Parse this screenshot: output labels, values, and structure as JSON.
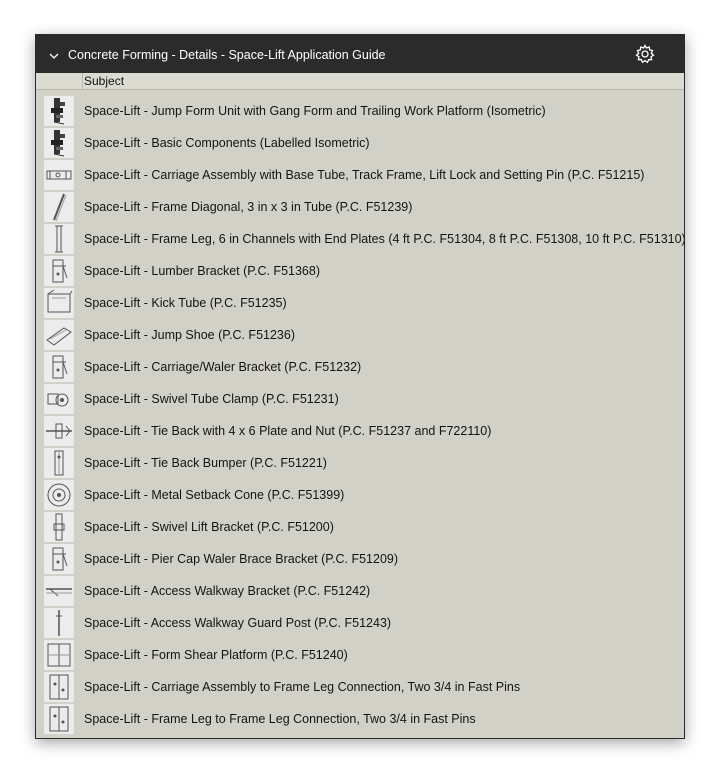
{
  "header": {
    "title": "Concrete Forming - Details - Space-Lift Application Guide",
    "chevron_icon": "chevron-down-icon",
    "settings_icon": "gear-icon"
  },
  "columns": {
    "subject": "Subject"
  },
  "rows": [
    {
      "label": "Space-Lift - Jump Form Unit with Gang Form and Trailing Work Platform (Isometric)",
      "thumb": "isometric-assembly-dark"
    },
    {
      "label": "Space-Lift - Basic Components (Labelled Isometric)",
      "thumb": "isometric-assembly-dark"
    },
    {
      "label": "Space-Lift - Carriage Assembly with Base Tube, Track Frame, Lift Lock and Setting Pin (P.C. F51215)",
      "thumb": "carriage-sketch"
    },
    {
      "label": "Space-Lift - Frame Diagonal, 3 in x 3 in Tube (P.C. F51239)",
      "thumb": "diagonal-tube"
    },
    {
      "label": "Space-Lift - Frame Leg, 6 in Channels with End Plates (4 ft P.C. F51304, 8 ft P.C. F51308, 10 ft P.C. F51310)",
      "thumb": "frame-leg"
    },
    {
      "label": "Space-Lift - Lumber Bracket (P.C. F51368)",
      "thumb": "bracket-sketch"
    },
    {
      "label": "Space-Lift - Kick Tube (P.C. F51235)",
      "thumb": "tube-sketch"
    },
    {
      "label": "Space-Lift - Jump Shoe (P.C. F51236)",
      "thumb": "shoe-sketch"
    },
    {
      "label": "Space-Lift - Carriage/Waler Bracket (P.C. F51232)",
      "thumb": "bracket-sketch"
    },
    {
      "label": "Space-Lift - Swivel Tube Clamp (P.C. F51231)",
      "thumb": "clamp-sketch"
    },
    {
      "label": "Space-Lift - Tie Back with 4 x 6 Plate and Nut (P.C. F51237 and F722110)",
      "thumb": "tieback-sketch"
    },
    {
      "label": "Space-Lift - Tie Back Bumper (P.C. F51221)",
      "thumb": "bumper-sketch"
    },
    {
      "label": "Space-Lift - Metal Setback Cone (P.C. F51399)",
      "thumb": "cone-sketch"
    },
    {
      "label": "Space-Lift - Swivel Lift Bracket (P.C. F51200)",
      "thumb": "lift-bracket-sketch"
    },
    {
      "label": "Space-Lift - Pier Cap Waler Brace Bracket (P.C. F51209)",
      "thumb": "bracket-sketch"
    },
    {
      "label": "Space-Lift - Access Walkway Bracket (P.C. F51242)",
      "thumb": "walkway-sketch"
    },
    {
      "label": "Space-Lift - Access Walkway Guard Post (P.C. F51243)",
      "thumb": "post-sketch"
    },
    {
      "label": "Space-Lift - Form Shear Platform (P.C. F51240)",
      "thumb": "platform-sketch"
    },
    {
      "label": "Space-Lift - Carriage Assembly to Frame Leg Connection, Two 3/4 in Fast Pins",
      "thumb": "connection-sketch"
    },
    {
      "label": "Space-Lift - Frame Leg to Frame Leg Connection, Two 3/4 in Fast Pins",
      "thumb": "connection-sketch"
    }
  ]
}
